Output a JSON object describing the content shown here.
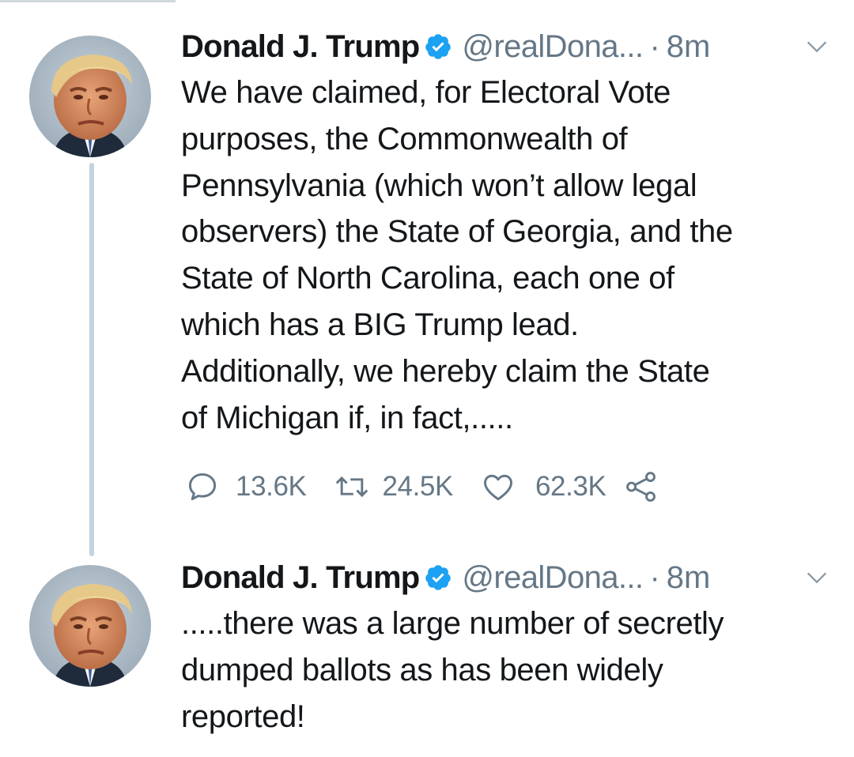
{
  "colors": {
    "text": "#14171a",
    "secondary": "#657786",
    "verified": "#1da1f2",
    "thread_line": "#c4d3df"
  },
  "tweets": [
    {
      "author_name": "Donald J. Trump",
      "verified_icon": "verified-badge-icon",
      "handle": "@realDona...",
      "separator": "·",
      "time": "8m",
      "text": "We have claimed, for Electoral Vote\npurposes, the Commonwealth of\nPennsylvania (which won’t allow legal\nobservers) the State of Georgia, and the\nState of North Carolina, each one of\nwhich has a BIG Trump lead.\nAdditionally, we hereby claim the State\nof Michigan if, in fact,.....",
      "replies": "13.6K",
      "retweets": "24.5K",
      "likes": "62.3K"
    },
    {
      "author_name": "Donald J. Trump",
      "verified_icon": "verified-badge-icon",
      "handle": "@realDona...",
      "separator": "·",
      "time": "8m",
      "text": ".....there was a large number of secretly\ndumped ballots as has been widely\nreported!"
    }
  ]
}
